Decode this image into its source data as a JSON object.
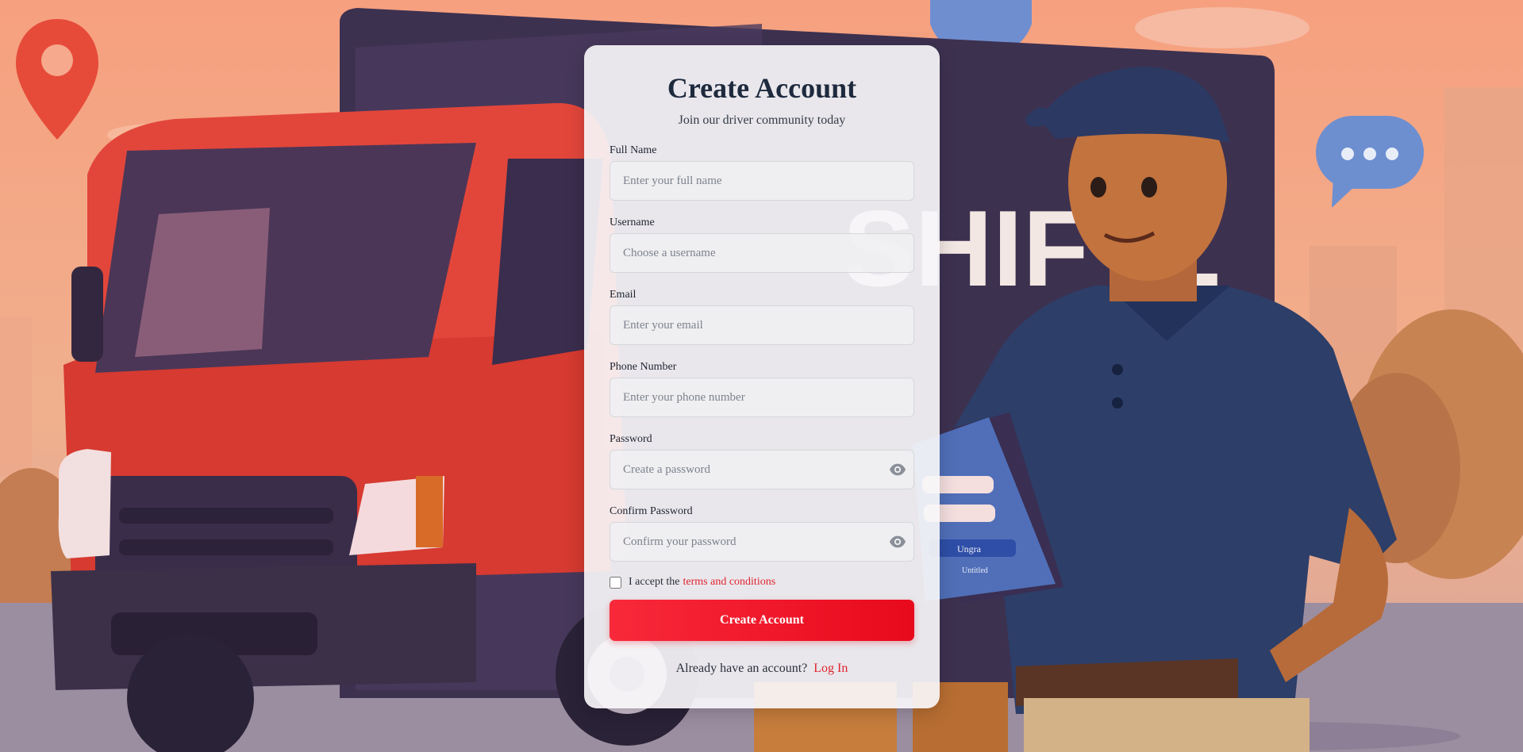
{
  "background": {
    "truck_text": "SHIFTL",
    "tablet_button": "Ungra",
    "tablet_footer": "Untitled"
  },
  "form": {
    "title": "Create Account",
    "subtitle": "Join our driver community today",
    "fields": [
      {
        "label": "Full Name",
        "placeholder": "Enter your full name",
        "value": ""
      },
      {
        "label": "Username",
        "placeholder": "Choose a username",
        "value": ""
      },
      {
        "label": "Email",
        "placeholder": "Enter your email",
        "value": ""
      },
      {
        "label": "Phone Number",
        "placeholder": "Enter your phone number",
        "value": ""
      },
      {
        "label": "Password",
        "placeholder": "Create a password",
        "value": "",
        "icon": "eye-icon"
      },
      {
        "label": "Confirm Password",
        "placeholder": "Confirm your password",
        "value": "",
        "icon": "eye-icon"
      }
    ],
    "terms_prefix": "I accept the",
    "terms_link": "terms and conditions",
    "terms_checked": false,
    "submit_label": "Create Account",
    "login_prompt": "Already have an account?",
    "login_link": "Log In"
  },
  "colors": {
    "accent": "#e8091c",
    "title": "#1e2a3e",
    "link": "#e0232e"
  }
}
